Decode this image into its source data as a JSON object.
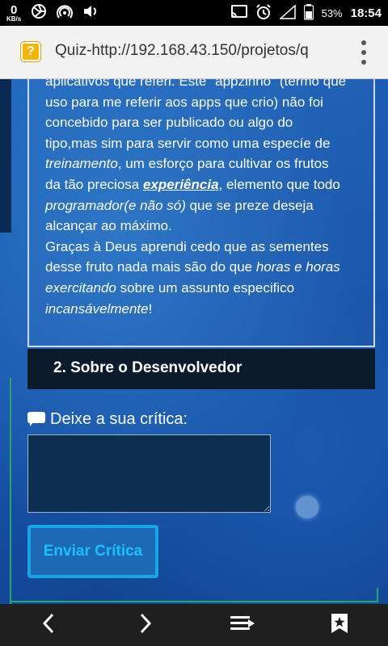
{
  "status_bar": {
    "net_speed_value": "0",
    "net_speed_unit": "KB/s",
    "battery_percent": "53%",
    "time": "18:54"
  },
  "browser": {
    "url": "Quiz-http://192.168.43.150/projetos/q",
    "favicon": "?"
  },
  "article": {
    "line1": "aplicativos que referi. Este \"appzinho\" (termo que",
    "line2": "uso para me referir aos apps que crio) não foi",
    "line3": "concebido para ser publicado ou algo do",
    "line4_a": "tipo,mas sim para servir como uma especíe de",
    "line5_em": "treinamento",
    "line5_b": ", um esforço para cultivar os frutos",
    "line6_a": "da tão preciosa ",
    "line6_exp": "experiência",
    "line6_b": ", elemento que todo",
    "line7_em": "programador(e não só)",
    "line7_b": " que se preze deseja",
    "line8": "alcançar ao máximo.",
    "line9": "Graças à Deus aprendi cedo que as sementes",
    "line10_a": "desse fruto nada mais são do que ",
    "line10_em": "horas e horas",
    "line11_em": "exercitando",
    "line11_b": " sobre um assunto especifico",
    "line12_em": "incansávelmente",
    "line12_b": "!"
  },
  "section_header": "2. Sobre o Desenvolvedor",
  "critique": {
    "label": "Deixe a sua crítica:",
    "value": "",
    "button": "Enviar Crítica"
  }
}
